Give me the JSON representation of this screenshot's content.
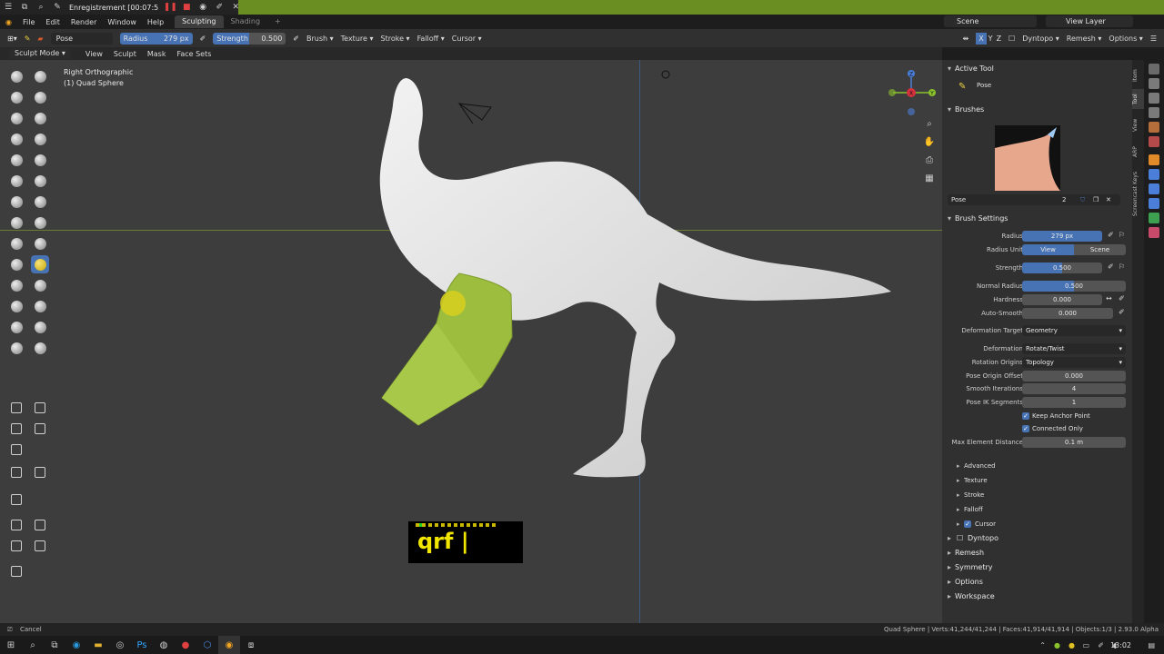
{
  "recorder": {
    "title": "Enregistrement [00:07:5"
  },
  "menu": {
    "items": [
      "File",
      "Edit",
      "Render",
      "Window",
      "Help"
    ],
    "workspaces": [
      "Sculpting",
      "Shading"
    ],
    "add_tab": "+",
    "scene": "Scene",
    "view_layer": "View Layer"
  },
  "tool_header": {
    "brush": "Pose",
    "radius_label": "Radius",
    "radius_value": "279 px",
    "strength_label": "Strength",
    "strength_value": "0.500",
    "strength_fraction": 0.5,
    "menus": [
      "Brush",
      "Texture",
      "Stroke",
      "Falloff",
      "Cursor"
    ],
    "xyz": [
      "X",
      "Y",
      "Z"
    ],
    "right_menus": [
      "Dyntopo",
      "Remesh",
      "Options"
    ]
  },
  "mode_header": {
    "mode": "Sculpt Mode",
    "items": [
      "View",
      "Sculpt",
      "Mask",
      "Face Sets"
    ]
  },
  "viewport": {
    "view_name": "Right Orthographic",
    "object_name": "(1) Quad Sphere",
    "gizmo": {
      "x": "X",
      "y": "Y",
      "z": "Z"
    }
  },
  "keycast": {
    "text": "qrf"
  },
  "properties": {
    "active_tool_title": "Active Tool",
    "active_tool_name": "Pose",
    "brushes_title": "Brushes",
    "brush_name": "Pose",
    "brush_users": "2",
    "brush_settings_title": "Brush Settings",
    "rows": {
      "radius": {
        "label": "Radius",
        "value": "279 px"
      },
      "radius_unit": {
        "label": "Radius Unit",
        "view": "View",
        "scene": "Scene"
      },
      "strength": {
        "label": "Strength",
        "value": "0.500",
        "fraction": 0.5
      },
      "normal_radius": {
        "label": "Normal Radius",
        "value": "0.500",
        "fraction": 0.5
      },
      "hardness": {
        "label": "Hardness",
        "value": "0.000"
      },
      "auto_smooth": {
        "label": "Auto-Smooth",
        "value": "0.000"
      },
      "deformation_target": {
        "label": "Deformation Target",
        "value": "Geometry"
      },
      "deformation": {
        "label": "Deformation",
        "value": "Rotate/Twist"
      },
      "rotation_origins": {
        "label": "Rotation Origins",
        "value": "Topology"
      },
      "pose_origin_offset": {
        "label": "Pose Origin Offset",
        "value": "0.000"
      },
      "smooth_iterations": {
        "label": "Smooth Iterations",
        "value": "4"
      },
      "pose_ik_segments": {
        "label": "Pose IK Segments",
        "value": "1"
      },
      "keep_anchor": {
        "label": "Keep Anchor Point"
      },
      "connected_only": {
        "label": "Connected Only"
      },
      "max_element_distance": {
        "label": "Max Element Distance",
        "value": "0.1 m"
      }
    },
    "subpanels": [
      "Advanced",
      "Texture",
      "Stroke",
      "Falloff",
      "Cursor"
    ],
    "panels": [
      "Dyntopo",
      "Remesh",
      "Symmetry",
      "Options",
      "Workspace"
    ]
  },
  "side_tabs": [
    "Item",
    "Tool",
    "View",
    "ARP",
    "Screencast Keys"
  ],
  "status": {
    "left": "Cancel",
    "right": "Quad Sphere | Verts:41,244/41,244 | Faces:41,914/41,914 | Objects:1/3 | 2.93.0 Alpha"
  },
  "taskbar": {
    "time": "13:02"
  },
  "colors": {
    "accent": "#4772b3",
    "mesh": "#e2e2e2",
    "mask_green": "#98b83c",
    "panel_bg": "#303030",
    "viewport_bg": "#3d3d3d"
  }
}
